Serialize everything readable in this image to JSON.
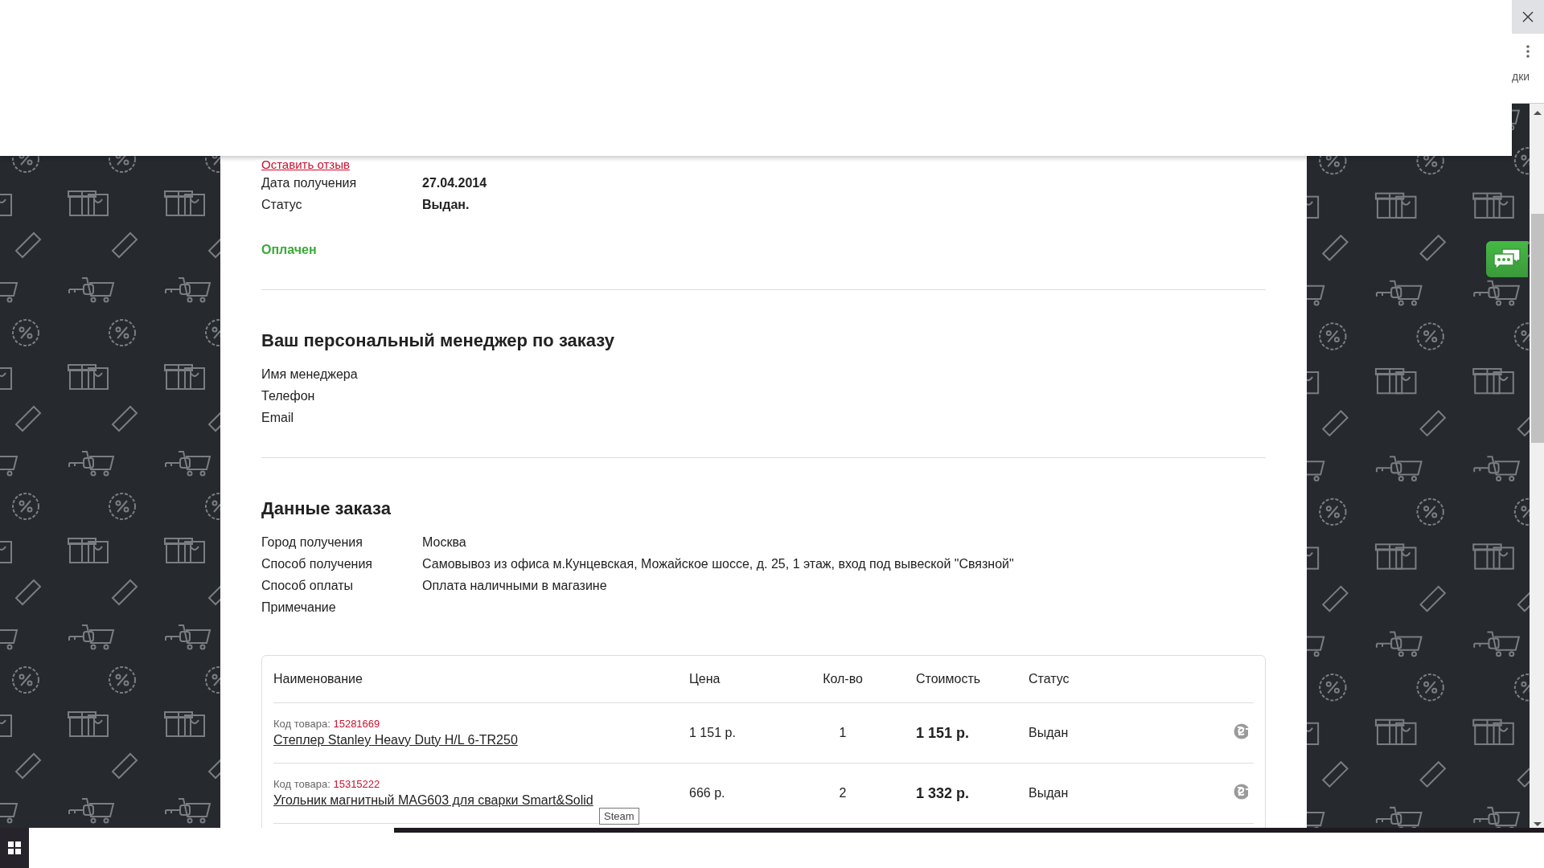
{
  "browser": {
    "side_text": "дки"
  },
  "order_info": {
    "review_link": "Оставить отзыв",
    "fields": [
      {
        "label": "Дата получения",
        "value": "27.04.2014"
      },
      {
        "label": "Статус",
        "value": "Выдан."
      }
    ],
    "payment_status": "Оплачен"
  },
  "manager": {
    "title": "Ваш персональный менеджер по заказу",
    "fields": [
      {
        "label": "Имя менеджера"
      },
      {
        "label": "Телефон"
      },
      {
        "label": "Email"
      }
    ]
  },
  "order_data": {
    "title": "Данные заказа",
    "fields": [
      {
        "label": "Город получения",
        "value": "Москва"
      },
      {
        "label": "Способ получения",
        "value": "Самовывоз из офиса м.Кунцевская, Можайское шоссе, д. 25, 1 этаж, вход под вывеской \"Связной\""
      },
      {
        "label": "Способ оплаты",
        "value": "Оплата наличными в магазине"
      },
      {
        "label": "Примечание"
      }
    ]
  },
  "table": {
    "columns": [
      "Наименование",
      "Цена",
      "Кол-во",
      "Стоимость",
      "Статус"
    ],
    "rows": [
      {
        "code_label": "Код товара:",
        "code": "15281669",
        "name": "Степлер Stanley Heavy Duty H/L 6-TR250",
        "price": "1 151 р.",
        "qty": "1",
        "cost": "1 151 р.",
        "status": "Выдан",
        "certified": true
      },
      {
        "code_label": "Код товара:",
        "code": "15315222",
        "name": "Угольник магнитный MAG603 для сварки Smart&Solid",
        "price": "666 р.",
        "qty": "2",
        "cost": "1 332 р.",
        "status": "Выдан",
        "certified": true
      }
    ]
  },
  "tooltip": "Steam"
}
